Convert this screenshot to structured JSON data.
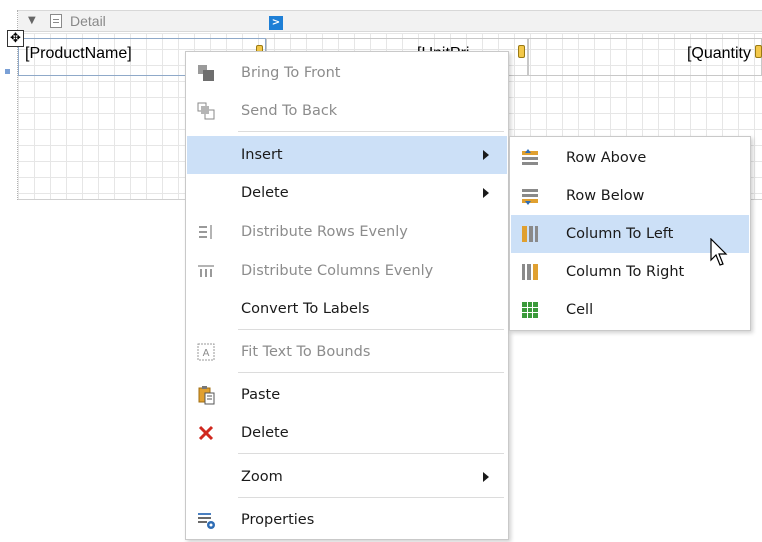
{
  "band": {
    "name": "Detail",
    "toggle_glyph": "▼",
    "smart_tag_glyph": ">"
  },
  "table": {
    "cells": [
      "[ProductName]",
      "[UnitPri",
      "[Quantity"
    ]
  },
  "move_handle_glyph": "✥",
  "context_menu": {
    "items": [
      {
        "label": "Bring To Front",
        "icon": "bring-to-front-icon",
        "enabled": false
      },
      {
        "label": "Send To Back",
        "icon": "send-to-back-icon",
        "enabled": false
      },
      {
        "label": "Insert",
        "icon": "",
        "enabled": true,
        "submenu": true,
        "highlighted": true
      },
      {
        "label": "Delete",
        "icon": "",
        "enabled": true,
        "submenu": true
      },
      {
        "label": "Distribute Rows Evenly",
        "icon": "distribute-rows-icon",
        "enabled": false
      },
      {
        "label": "Distribute Columns Evenly",
        "icon": "distribute-columns-icon",
        "enabled": false
      },
      {
        "label": "Convert To Labels",
        "icon": "",
        "enabled": true
      },
      {
        "label": "Fit Text To Bounds",
        "icon": "fit-text-icon",
        "enabled": false
      },
      {
        "label": "Paste",
        "icon": "paste-icon",
        "enabled": true
      },
      {
        "label": "Delete",
        "icon": "delete-x-icon",
        "enabled": true
      },
      {
        "label": "Zoom",
        "icon": "",
        "enabled": true,
        "submenu": true
      },
      {
        "label": "Properties",
        "icon": "properties-icon",
        "enabled": true
      }
    ]
  },
  "insert_submenu": {
    "items": [
      {
        "label": "Row Above",
        "icon": "row-above-icon"
      },
      {
        "label": "Row Below",
        "icon": "row-below-icon"
      },
      {
        "label": "Column To Left",
        "icon": "column-left-icon",
        "highlighted": true
      },
      {
        "label": "Column To Right",
        "icon": "column-right-icon"
      },
      {
        "label": "Cell",
        "icon": "cell-icon"
      }
    ]
  },
  "colors": {
    "highlight": "#cce0f7",
    "smart_tag": "#1e7fd6",
    "delete_red": "#d0281e",
    "icon_orange": "#e0a030",
    "icon_green": "#3a9a3a"
  }
}
